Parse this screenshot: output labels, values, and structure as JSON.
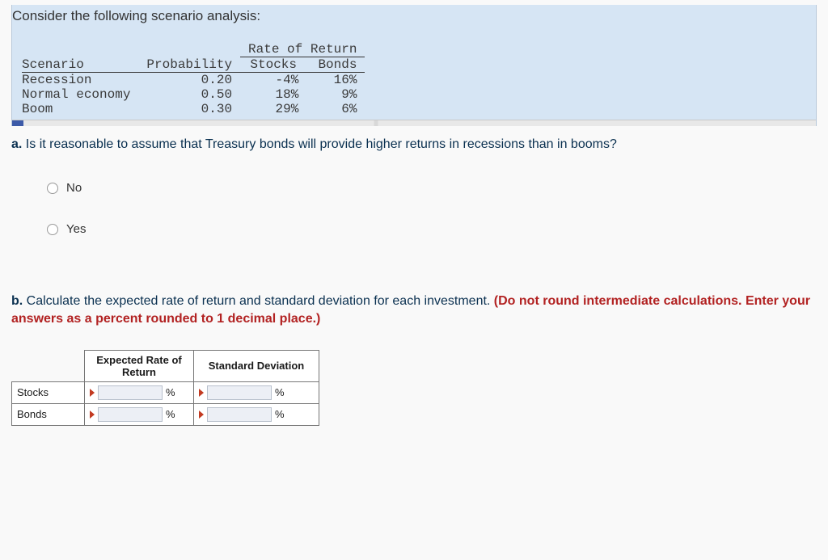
{
  "prompt": "Consider the following scenario analysis:",
  "table": {
    "group_header": "Rate of Return",
    "cols": {
      "scenario": "Scenario",
      "prob": "Probability",
      "stocks": "Stocks",
      "bonds": "Bonds"
    },
    "rows": [
      {
        "scenario": "Recession",
        "prob": "0.20",
        "stocks": "-4%",
        "bonds": "16%"
      },
      {
        "scenario": "Normal economy",
        "prob": "0.50",
        "stocks": "18%",
        "bonds": "9%"
      },
      {
        "scenario": "Boom",
        "prob": "0.30",
        "stocks": "29%",
        "bonds": "6%"
      }
    ]
  },
  "question_a": {
    "label": "a.",
    "text": "Is it reasonable to assume that Treasury bonds will provide higher returns in recessions than in booms?",
    "options": {
      "no": "No",
      "yes": "Yes"
    }
  },
  "question_b": {
    "label": "b.",
    "text": "Calculate the expected rate of return and standard deviation for each investment. ",
    "warn": "(Do not round intermediate calculations. Enter your answers as a percent rounded to 1 decimal place.)"
  },
  "answers": {
    "headers": {
      "err": "Expected Rate of Return",
      "sd": "Standard Deviation"
    },
    "rows": {
      "stocks": "Stocks",
      "bonds": "Bonds"
    },
    "unit": "%"
  },
  "chart_data": {
    "type": "table",
    "columns": [
      "Scenario",
      "Probability",
      "Stocks",
      "Bonds"
    ],
    "data": [
      [
        "Recession",
        0.2,
        -4,
        16
      ],
      [
        "Normal economy",
        0.5,
        18,
        9
      ],
      [
        "Boom",
        0.3,
        29,
        6
      ]
    ],
    "units": {
      "Stocks": "%",
      "Bonds": "%"
    },
    "title": "Rate of Return"
  }
}
